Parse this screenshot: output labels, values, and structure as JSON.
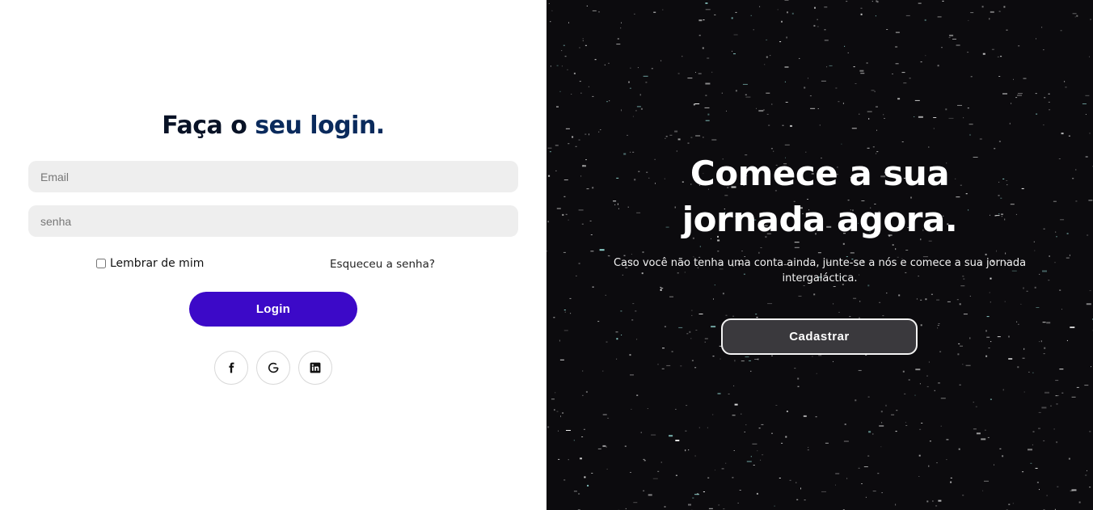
{
  "login": {
    "title_part1": "Faça o",
    "title_part2": " seu login.",
    "email_placeholder": "Email",
    "password_placeholder": "senha",
    "remember_label": "Lembrar de mim",
    "forgot_label": "Esqueceu a senha?",
    "login_button": "Login",
    "social": [
      {
        "icon": "facebook-icon"
      },
      {
        "icon": "google-icon"
      },
      {
        "icon": "linkedin-icon"
      }
    ]
  },
  "signup": {
    "title_line1": "Comece a sua",
    "title_line2": "jornada agora.",
    "description": "Caso você não tenha uma conta ainda, junte-se a nós e comece a sua jornada intergaláctica.",
    "button": "Cadastrar"
  },
  "colors": {
    "login_button": "#3c09c8",
    "title_dark": "#081226",
    "title_blue": "#0a2a5c",
    "right_background": "#0c0b0e",
    "signup_button": "#3a393d"
  }
}
